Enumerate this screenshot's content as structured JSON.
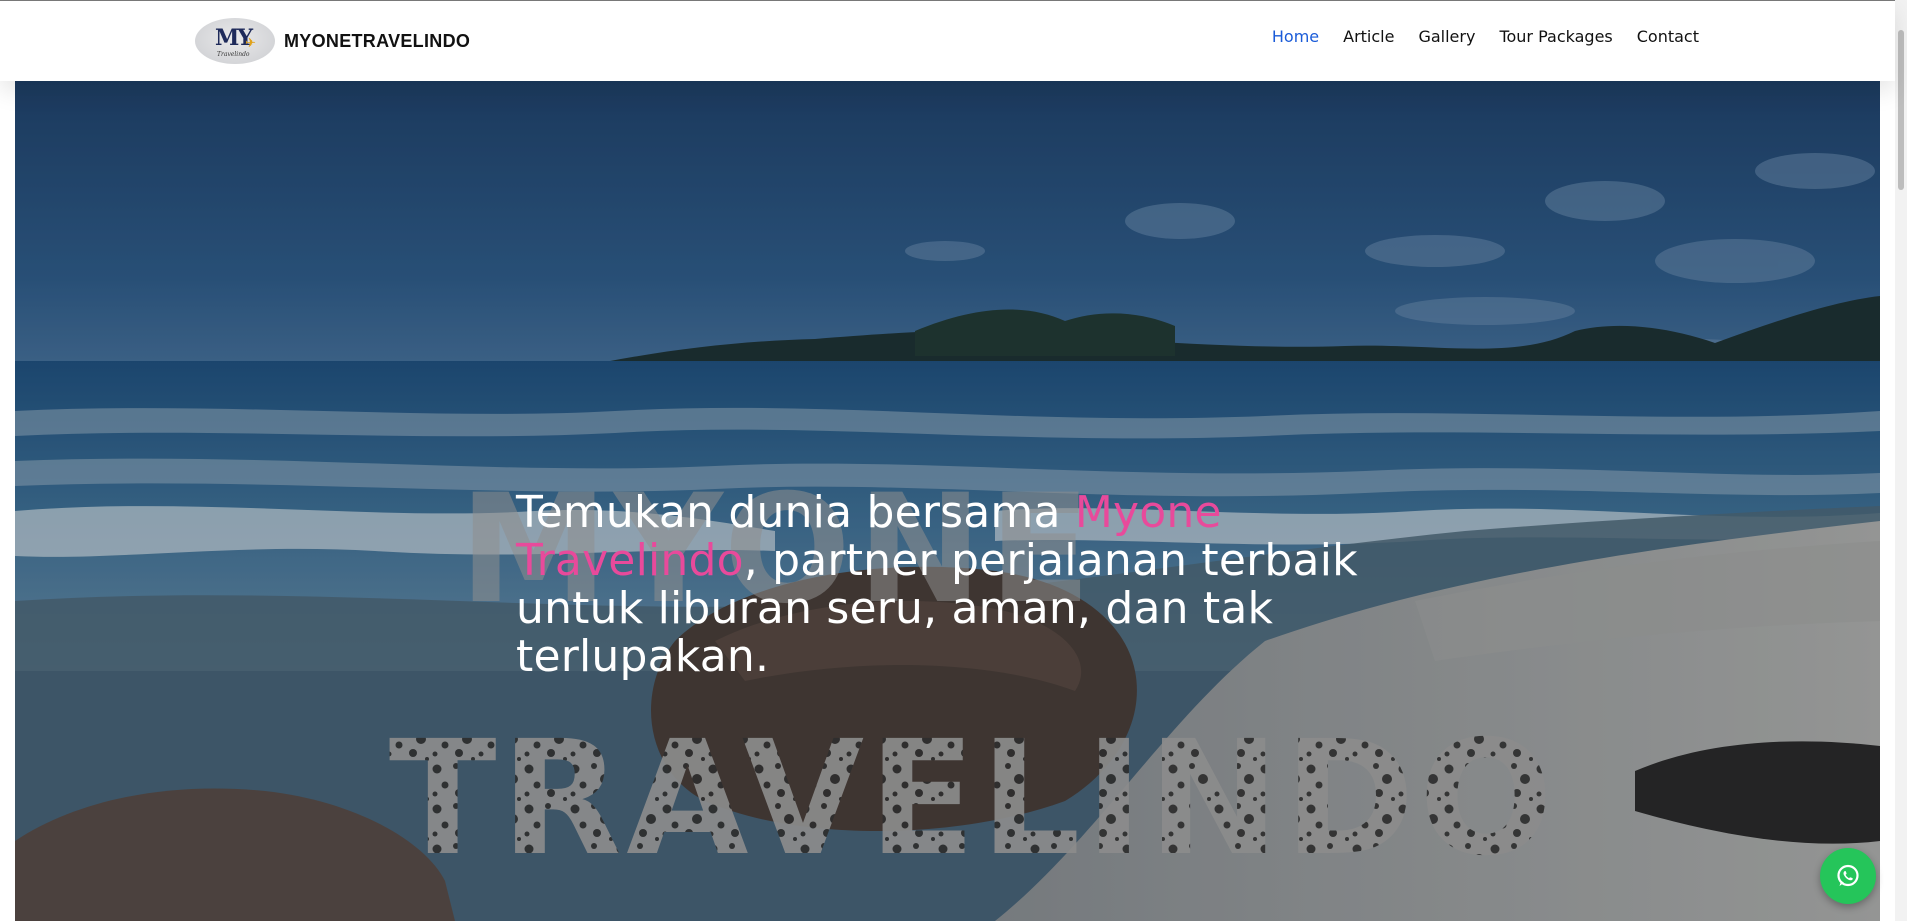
{
  "navbar": {
    "brand_name": "MYONETRAVELINDO",
    "logo": {
      "letters": "MY",
      "script": "Travelindo"
    },
    "links": [
      {
        "label": "Home",
        "active": true
      },
      {
        "label": "Article",
        "active": false
      },
      {
        "label": "Gallery",
        "active": false
      },
      {
        "label": "Tour Packages",
        "active": false
      },
      {
        "label": "Contact",
        "active": false
      }
    ],
    "active_color": "#1a5bd8"
  },
  "hero": {
    "watermark_line1": "MYONE",
    "watermark_line2": "TRAVELINDO",
    "headline_prefix": "Temukan dunia bersama ",
    "headline_accent": "Myone Travelindo",
    "headline_suffix": ", partner perjalanan terbaik untuk liburan seru, aman, dan tak terlupakan.",
    "accent_color": "#e84a9b"
  },
  "floating_button": {
    "icon": "whatsapp-icon",
    "color": "#25c55a"
  }
}
